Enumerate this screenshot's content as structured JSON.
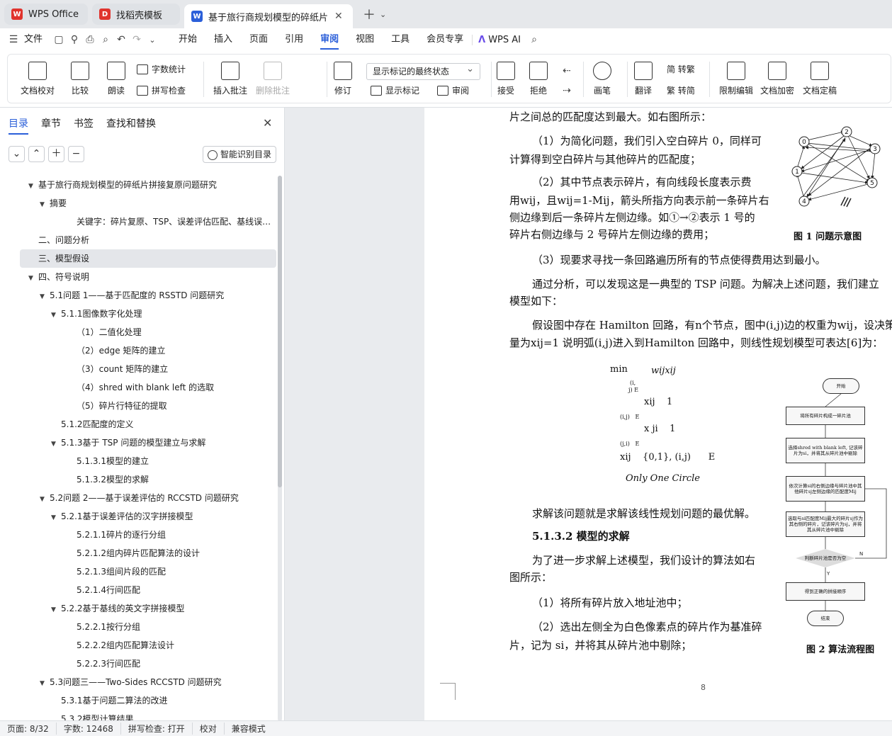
{
  "tabs": [
    {
      "label": "WPS Office",
      "icon": "wps-logo-icon",
      "color": "#e0332d"
    },
    {
      "label": "找稻壳模板",
      "icon": "docer-logo-icon",
      "color": "#e0332d"
    },
    {
      "label": "基于旅行商规划模型的碎纸片…",
      "icon": "wps-writer-icon",
      "color": "#2b5fd9"
    }
  ],
  "menu": {
    "file": "文件",
    "items": [
      "开始",
      "插入",
      "页面",
      "引用",
      "审阅",
      "视图",
      "工具",
      "会员专享"
    ],
    "active": "审阅",
    "ai": "WPS AI"
  },
  "ribbon": {
    "proofread": "文档校对",
    "compare": "比较",
    "read": "朗读",
    "wordcount": "字数统计",
    "spellcheck": "拼写检查",
    "insert_comment": "插入批注",
    "delete_comment": "删除批注",
    "revise": "修订",
    "markup_select": "显示标记的最终状态",
    "show_markup": "显示标记",
    "review": "审阅",
    "accept": "接受",
    "reject": "拒绝",
    "pen": "画笔",
    "translate": "翻译",
    "to_trad": "简 转繁",
    "to_simp": "繁 转简",
    "restrict": "限制编辑",
    "encrypt": "文档加密",
    "finalize": "文档定稿"
  },
  "sidebar": {
    "tabs": [
      "目录",
      "章节",
      "书签",
      "查找和替换"
    ],
    "smart": "智能识别目录",
    "toc": [
      {
        "t": "基于旅行商规划模型的碎纸片拼接复原问题研究",
        "l": 0,
        "e": true
      },
      {
        "t": "摘要",
        "l": 1,
        "e": true
      },
      {
        "t": "关键字：碎片复原、TSP、误差评估匹配、基线误…",
        "l": 3,
        "e": false
      },
      {
        "t": "二、问题分析",
        "l": 0,
        "e": false
      },
      {
        "t": "三、模型假设",
        "l": 0,
        "e": false,
        "sel": true
      },
      {
        "t": "四、符号说明",
        "l": 0,
        "e": true
      },
      {
        "t": "5.1问题 1——基于匹配度的 RSSTD 问题研究",
        "l": 1,
        "e": true
      },
      {
        "t": "5.1.1图像数字化处理",
        "l": 2,
        "e": true
      },
      {
        "t": "（1）二值化处理",
        "l": 3,
        "e": false
      },
      {
        "t": "（2）edge 矩阵的建立",
        "l": 3,
        "e": false
      },
      {
        "t": "（3）count 矩阵的建立",
        "l": 3,
        "e": false
      },
      {
        "t": "（4）shred with blank left 的选取",
        "l": 3,
        "e": false
      },
      {
        "t": "（5）碎片行特征的提取",
        "l": 3,
        "e": false
      },
      {
        "t": "5.1.2匹配度的定义",
        "l": 2,
        "e": false
      },
      {
        "t": "5.1.3基于 TSP 问题的模型建立与求解",
        "l": 2,
        "e": true
      },
      {
        "t": "5.1.3.1模型的建立",
        "l": 3,
        "e": false
      },
      {
        "t": "5.1.3.2模型的求解",
        "l": 3,
        "e": false
      },
      {
        "t": "5.2问题 2——基于误差评估的 RCCSTD 问题研究",
        "l": 1,
        "e": true
      },
      {
        "t": "5.2.1基于误差评估的汉字拼接模型",
        "l": 2,
        "e": true
      },
      {
        "t": "5.2.1.1碎片的逐行分组",
        "l": 3,
        "e": false
      },
      {
        "t": "5.2.1.2组内碎片匹配算法的设计",
        "l": 3,
        "e": false
      },
      {
        "t": "5.2.1.3组间片段的匹配",
        "l": 3,
        "e": false
      },
      {
        "t": "5.2.1.4行间匹配",
        "l": 3,
        "e": false
      },
      {
        "t": "5.2.2基于基线的英文字拼接模型",
        "l": 2,
        "e": true
      },
      {
        "t": "5.2.2.1按行分组",
        "l": 3,
        "e": false
      },
      {
        "t": "5.2.2.2组内匹配算法设计",
        "l": 3,
        "e": false
      },
      {
        "t": "5.2.2.3行间匹配",
        "l": 3,
        "e": false
      },
      {
        "t": "5.3问题三——Two-Sides RCCSTD 问题研究",
        "l": 1,
        "e": true
      },
      {
        "t": "5.3.1基于问题二算法的改进",
        "l": 2,
        "e": false
      },
      {
        "t": "5.3.2模型计算结果",
        "l": 2,
        "e": false
      }
    ]
  },
  "doc": {
    "lines": [
      "片之间总的匹配度达到最大。如右图所示：",
      "（1）为简化问题，我们引入空白碎片 0，同样可",
      "计算得到空白碎片与其他碎片的匹配度；",
      "（2）其中节点表示碎片，有向线段长度表示费",
      "用wij，且wij=1-Mij，箭头所指方向表示前一条碎片右",
      "侧边缘到后一条碎片左侧边缘。如①→②表示 1 号的",
      "碎片右侧边缘与 2 号碎片左侧边缘的费用；",
      "（3）现要求寻找一条回路遍历所有的节点使得费用达到最小。",
      "通过分析，可以发现这是一典型的 TSP 问题。为解决上述问题，我们建立",
      "模型如下：",
      "假设图中存在 Hamilton 回路，有n个节点，图中(i,j)边的权重为wij，设决策",
      "量为xij=1 说明弧(i,j)进入到Hamilton 回路中，则线性规划模型可表达[6]为：",
      "求解该问题就是求解该线性规划问题的最优解。",
      "5.1.3.2  模型的求解",
      "为了进一步求解上述模型，我们设计的算法如右",
      "图所示：",
      "（1）将所有碎片放入地址池中；",
      "（2）选出左侧全为白色像素点的碎片作为基准碎",
      "片，记为 si，并将其从碎片池中剔除；"
    ],
    "fig1_caption": "图 1 问题示意图",
    "fig2_caption": "图 2 算法流程图",
    "formula": {
      "min": "min",
      "obj": "wijxij",
      "sum1": "(i,",
      "sum1b": "j) E",
      "c1": "xij    1",
      "c1s": "(i,j)   E",
      "c2": "x ji    1",
      "c2s": "(j,i)   E",
      "c3": "xij    {0,1}, (i,j)      E",
      "c4": "Only One Circle"
    },
    "nodes": [
      "0",
      "2",
      "3",
      "1",
      "5",
      "4"
    ],
    "flow": {
      "start": "开始",
      "s1": "将所有碎片构成一碎片池",
      "s2": "选择shred with blank left, 记该碎片为si，并将其从碎片池中剔除",
      "s3": "依次计算si的右侧边缘与碎片池中其他碎片sj左侧边缘的匹配度Mij",
      "s4": "选取与si匹配度Mij最大的碎片sj作为其右侧的碎片，记该碎片为sj，并将其从碎片池中剔除",
      "d": "判断碎片池是否为空",
      "n": "N",
      "y": "Y",
      "s5": "得到正确的拼接顺序",
      "end": "结束"
    },
    "page_number": "8"
  },
  "status": [
    "页面: 8/32",
    "字数: 12468",
    "拼写检查: 打开",
    "校对",
    "兼容模式"
  ]
}
